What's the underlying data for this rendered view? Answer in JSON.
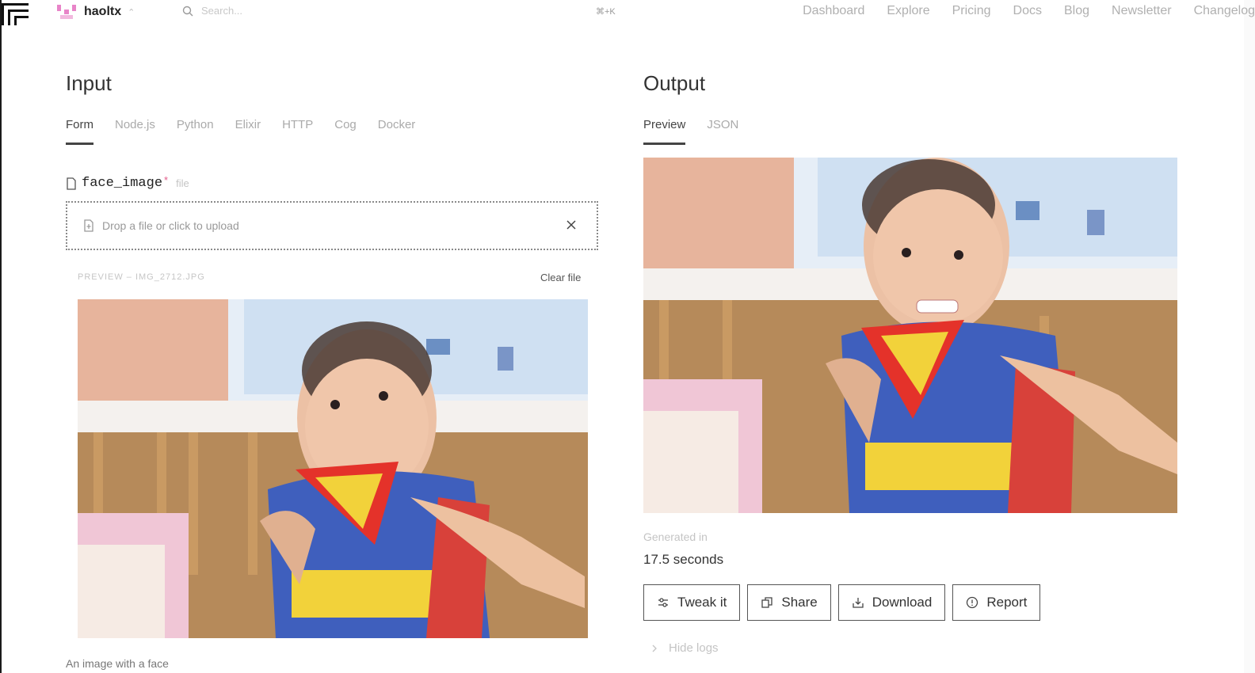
{
  "team": {
    "name": "haoltx"
  },
  "search": {
    "placeholder": "Search...",
    "shortcut": "⌘+K"
  },
  "nav": {
    "items": [
      "Dashboard",
      "Explore",
      "Pricing",
      "Docs",
      "Blog",
      "Newsletter",
      "Changelog"
    ]
  },
  "input": {
    "title": "Input",
    "tabs": [
      "Form",
      "Node.js",
      "Python",
      "Elixir",
      "HTTP",
      "Cog",
      "Docker"
    ],
    "active_tab": "Form",
    "field": {
      "name": "face_image",
      "required_mark": "*",
      "type": "file",
      "dropzone_text": "Drop a file or click to upload",
      "preview_label": "PREVIEW – IMG_2712.JPG",
      "clear_label": "Clear file",
      "description": "An image with a face"
    }
  },
  "output": {
    "title": "Output",
    "tabs": [
      "Preview",
      "JSON"
    ],
    "active_tab": "Preview",
    "generated_label": "Generated in",
    "generated_value": "17.5 seconds",
    "actions": [
      "Tweak it",
      "Share",
      "Download",
      "Report"
    ],
    "logs_label": "Hide logs"
  },
  "colors": {
    "accent": "#e35d8a",
    "text": "#222222",
    "muted": "#b0b0b0",
    "border": "#555555"
  }
}
